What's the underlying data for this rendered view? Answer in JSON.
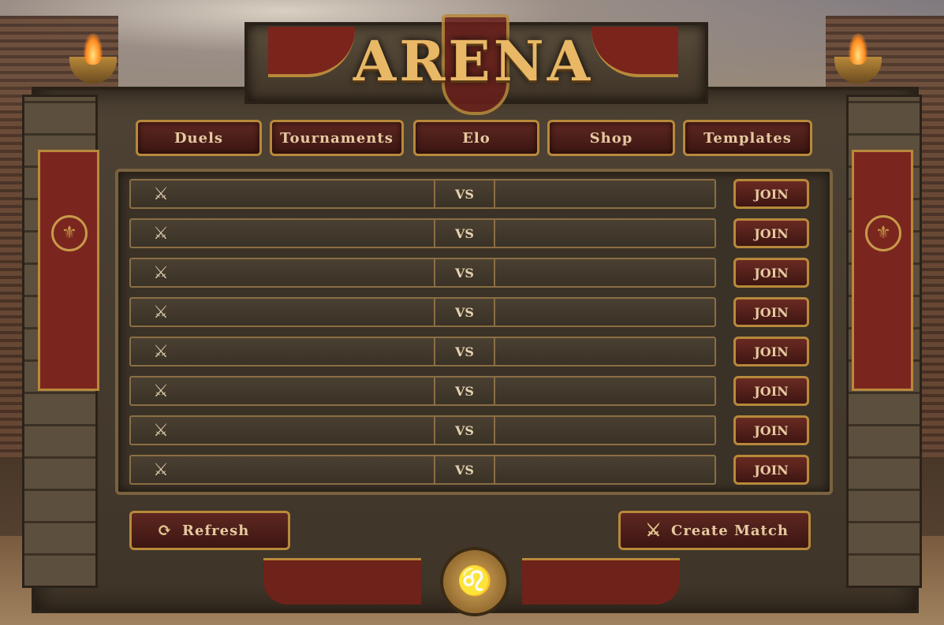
{
  "title": "ARENA",
  "nav": {
    "tabs": [
      "Duels",
      "Tournaments",
      "Elo",
      "Shop",
      "Templates"
    ]
  },
  "matches": {
    "vs_label": "VS",
    "join_label": "JOIN",
    "rows": [
      {
        "left": "",
        "right": ""
      },
      {
        "left": "",
        "right": ""
      },
      {
        "left": "",
        "right": ""
      },
      {
        "left": "",
        "right": ""
      },
      {
        "left": "",
        "right": ""
      },
      {
        "left": "",
        "right": ""
      },
      {
        "left": "",
        "right": ""
      },
      {
        "left": "",
        "right": ""
      }
    ]
  },
  "actions": {
    "refresh_label": "Refresh",
    "create_label": "Create Match"
  },
  "icons": {
    "match": "crossed-swords-icon",
    "refresh": "refresh-icon",
    "create": "crossed-swords-icon",
    "crest": "lion-head-icon",
    "banner": "helmet-laurel-icon"
  },
  "colors": {
    "gold": "#b8893a",
    "crimson": "#5e2720",
    "stone": "#3b3227",
    "text": "#e6c9a0"
  }
}
